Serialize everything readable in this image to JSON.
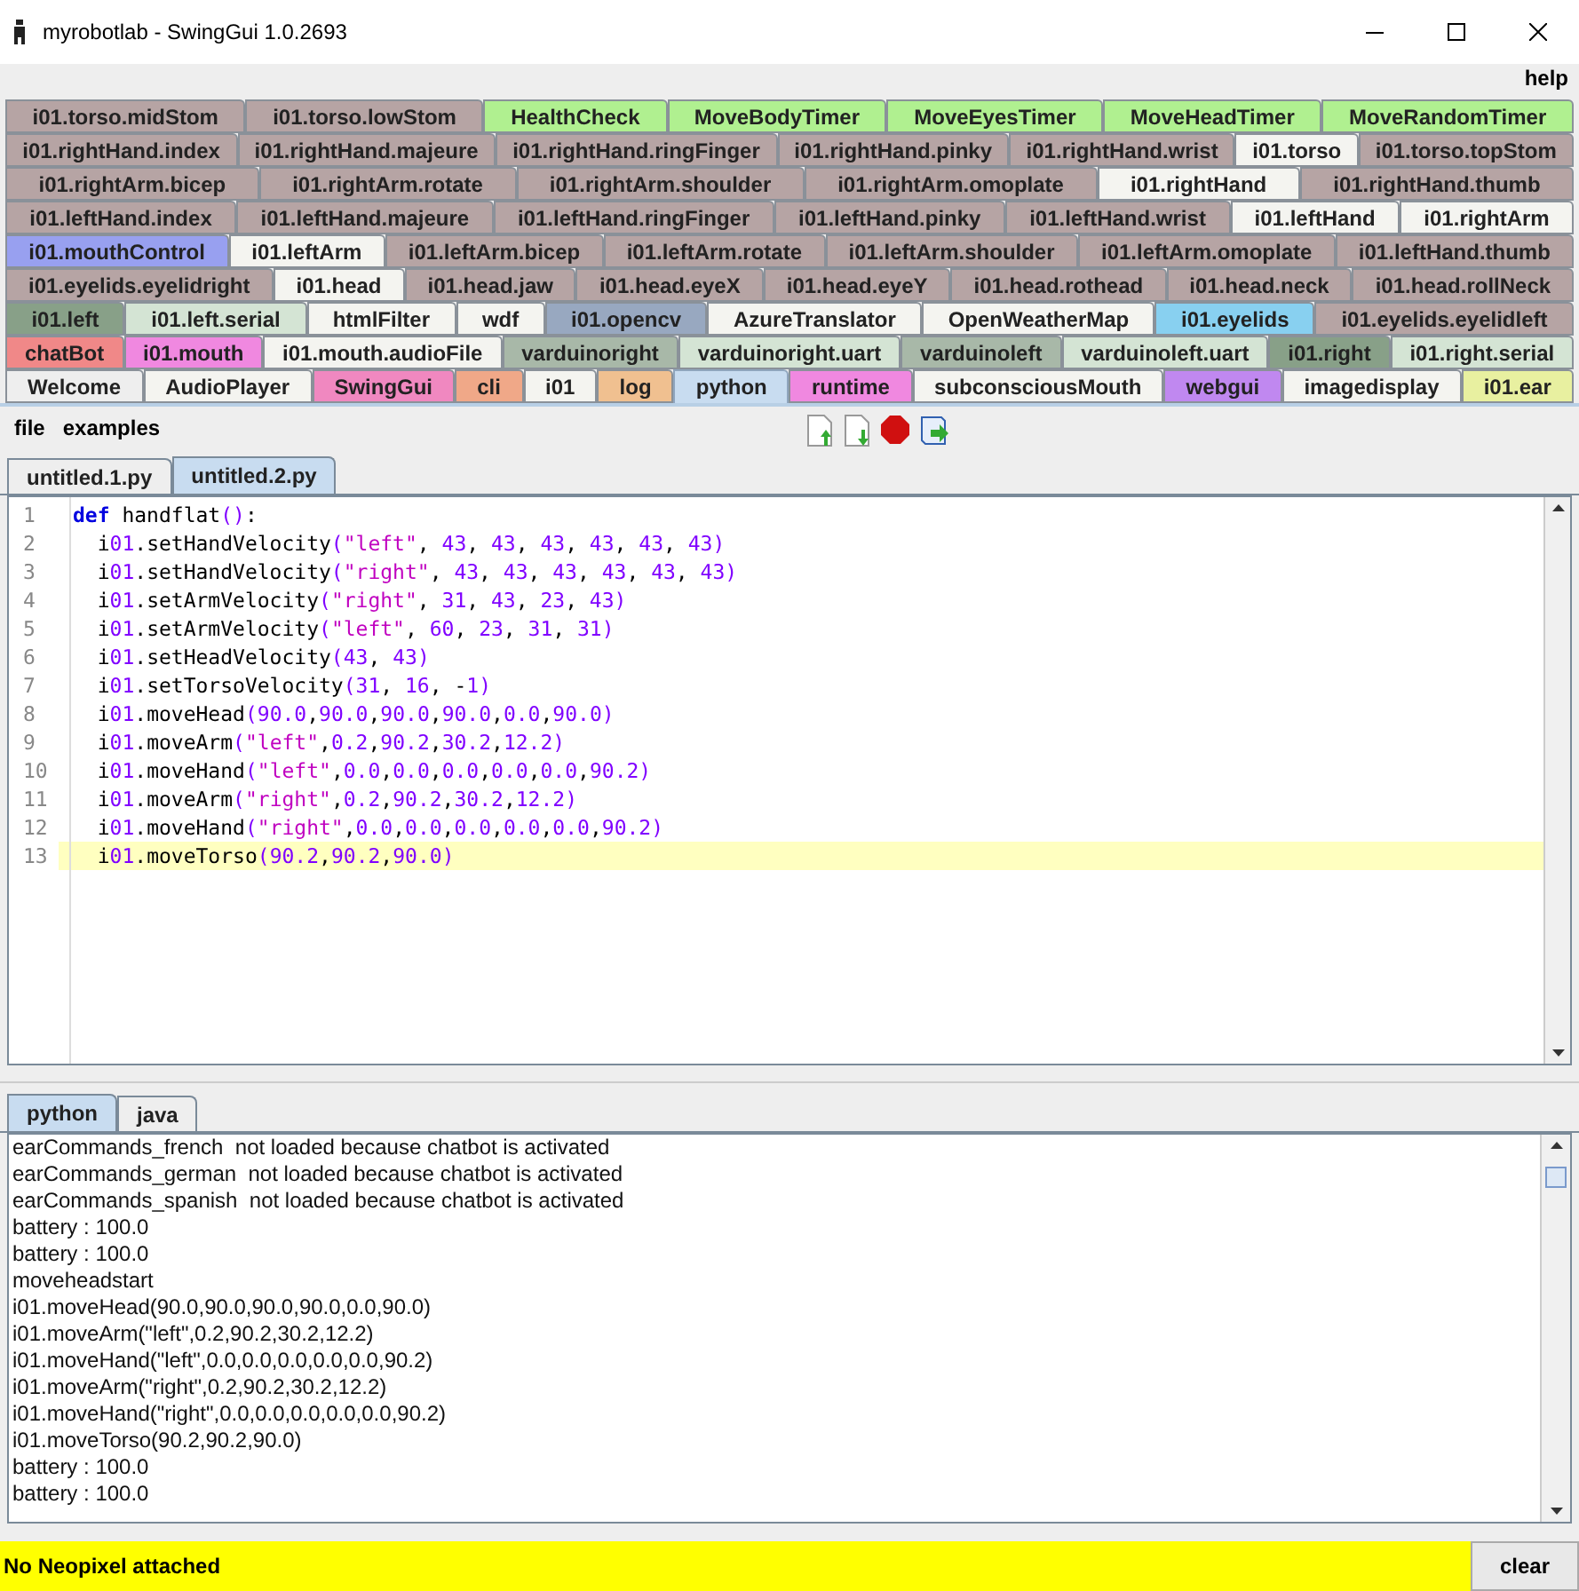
{
  "window": {
    "title": "myrobotlab - SwingGui 1.0.2693"
  },
  "menu": [
    "help"
  ],
  "tab_rows": [
    [
      {
        "label": "i01.torso.midStom",
        "color": "#b6a4a4",
        "selected": false
      },
      {
        "label": "i01.torso.lowStom",
        "color": "#b6a4a4",
        "selected": false
      },
      {
        "label": "HealthCheck",
        "color": "#b0f090",
        "selected": false
      },
      {
        "label": "MoveBodyTimer",
        "color": "#b0f090",
        "selected": false
      },
      {
        "label": "MoveEyesTimer",
        "color": "#b0f090",
        "selected": false
      },
      {
        "label": "MoveHeadTimer",
        "color": "#b0f090",
        "selected": false
      },
      {
        "label": "MoveRandomTimer",
        "color": "#b0f090",
        "selected": false
      }
    ],
    [
      {
        "label": "i01.rightHand.index",
        "color": "#b6a4a4",
        "selected": false
      },
      {
        "label": "i01.rightHand.majeure",
        "color": "#b6a4a4",
        "selected": false
      },
      {
        "label": "i01.rightHand.ringFinger",
        "color": "#b6a4a4",
        "selected": false
      },
      {
        "label": "i01.rightHand.pinky",
        "color": "#b6a4a4",
        "selected": false
      },
      {
        "label": "i01.rightHand.wrist",
        "color": "#b6a4a4",
        "selected": false
      },
      {
        "label": "i01.torso",
        "color": "#f4f4f0",
        "selected": false
      },
      {
        "label": "i01.torso.topStom",
        "color": "#b6a4a4",
        "selected": false
      }
    ],
    [
      {
        "label": "i01.rightArm.bicep",
        "color": "#b6a4a4",
        "selected": false
      },
      {
        "label": "i01.rightArm.rotate",
        "color": "#b6a4a4",
        "selected": false
      },
      {
        "label": "i01.rightArm.shoulder",
        "color": "#b6a4a4",
        "selected": false
      },
      {
        "label": "i01.rightArm.omoplate",
        "color": "#b6a4a4",
        "selected": false
      },
      {
        "label": "i01.rightHand",
        "color": "#f4f4f0",
        "selected": false
      },
      {
        "label": "i01.rightHand.thumb",
        "color": "#b6a4a4",
        "selected": false
      }
    ],
    [
      {
        "label": "i01.leftHand.index",
        "color": "#b6a4a4",
        "selected": false
      },
      {
        "label": "i01.leftHand.majeure",
        "color": "#b6a4a4",
        "selected": false
      },
      {
        "label": "i01.leftHand.ringFinger",
        "color": "#b6a4a4",
        "selected": false
      },
      {
        "label": "i01.leftHand.pinky",
        "color": "#b6a4a4",
        "selected": false
      },
      {
        "label": "i01.leftHand.wrist",
        "color": "#b6a4a4",
        "selected": false
      },
      {
        "label": "i01.leftHand",
        "color": "#f4f4f0",
        "selected": false
      },
      {
        "label": "i01.rightArm",
        "color": "#f4f4f0",
        "selected": false
      }
    ],
    [
      {
        "label": "i01.mouthControl",
        "color": "#98a0f0",
        "selected": false
      },
      {
        "label": "i01.leftArm",
        "color": "#f4f4f0",
        "selected": false
      },
      {
        "label": "i01.leftArm.bicep",
        "color": "#b6a4a4",
        "selected": false
      },
      {
        "label": "i01.leftArm.rotate",
        "color": "#b6a4a4",
        "selected": false
      },
      {
        "label": "i01.leftArm.shoulder",
        "color": "#b6a4a4",
        "selected": false
      },
      {
        "label": "i01.leftArm.omoplate",
        "color": "#b6a4a4",
        "selected": false
      },
      {
        "label": "i01.leftHand.thumb",
        "color": "#b6a4a4",
        "selected": false
      }
    ],
    [
      {
        "label": "i01.eyelids.eyelidright",
        "color": "#b6a4a4",
        "selected": false
      },
      {
        "label": "i01.head",
        "color": "#f4f4f0",
        "selected": false
      },
      {
        "label": "i01.head.jaw",
        "color": "#b6a4a4",
        "selected": false
      },
      {
        "label": "i01.head.eyeX",
        "color": "#b6a4a4",
        "selected": false
      },
      {
        "label": "i01.head.eyeY",
        "color": "#b6a4a4",
        "selected": false
      },
      {
        "label": "i01.head.rothead",
        "color": "#b6a4a4",
        "selected": false
      },
      {
        "label": "i01.head.neck",
        "color": "#b6a4a4",
        "selected": false
      },
      {
        "label": "i01.head.rollNeck",
        "color": "#b6a4a4",
        "selected": false
      }
    ],
    [
      {
        "label": "i01.left",
        "color": "#88a088",
        "selected": false
      },
      {
        "label": "i01.left.serial",
        "color": "#d4e4d4",
        "selected": false
      },
      {
        "label": "htmlFilter",
        "color": "#f4f4f0",
        "selected": false
      },
      {
        "label": "wdf",
        "color": "#f4f4f0",
        "selected": false
      },
      {
        "label": "i01.opencv",
        "color": "#98a8c0",
        "selected": false
      },
      {
        "label": "AzureTranslator",
        "color": "#f4f4f0",
        "selected": false
      },
      {
        "label": "OpenWeatherMap",
        "color": "#f4f4f0",
        "selected": false
      },
      {
        "label": "i01.eyelids",
        "color": "#88d0f0",
        "selected": false
      },
      {
        "label": "i01.eyelids.eyelidleft",
        "color": "#b6a4a4",
        "selected": false
      }
    ],
    [
      {
        "label": "chatBot",
        "color": "#f08888",
        "selected": false
      },
      {
        "label": "i01.mouth",
        "color": "#f088e0",
        "selected": false
      },
      {
        "label": "i01.mouth.audioFile",
        "color": "#f4f4f0",
        "selected": false
      },
      {
        "label": "varduinoright",
        "color": "#a8b8a8",
        "selected": false
      },
      {
        "label": "varduinoright.uart",
        "color": "#d4e4d4",
        "selected": false
      },
      {
        "label": "varduinoleft",
        "color": "#a8b8a8",
        "selected": false
      },
      {
        "label": "varduinoleft.uart",
        "color": "#d4e4d4",
        "selected": false
      },
      {
        "label": "i01.right",
        "color": "#88a088",
        "selected": false
      },
      {
        "label": "i01.right.serial",
        "color": "#d4e4d4",
        "selected": false
      }
    ],
    [
      {
        "label": "Welcome",
        "color": "#eeeeee",
        "selected": false
      },
      {
        "label": "AudioPlayer",
        "color": "#f4f4f0",
        "selected": false
      },
      {
        "label": "SwingGui",
        "color": "#f088c0",
        "selected": false
      },
      {
        "label": "cli",
        "color": "#f0a888",
        "selected": false
      },
      {
        "label": "i01",
        "color": "#f4f4f0",
        "selected": false
      },
      {
        "label": "log",
        "color": "#f0c090",
        "selected": false
      },
      {
        "label": "python",
        "color": "#c8dcf0",
        "selected": true
      },
      {
        "label": "runtime",
        "color": "#f088e0",
        "selected": false
      },
      {
        "label": "subconsciousMouth",
        "color": "#f4f4f0",
        "selected": false
      },
      {
        "label": "webgui",
        "color": "#c088f0",
        "selected": false
      },
      {
        "label": "imagedisplay",
        "color": "#f4f4f0",
        "selected": false
      },
      {
        "label": "i01.ear",
        "color": "#e8f0a0",
        "selected": false
      }
    ]
  ],
  "python_menu": [
    "file",
    "examples"
  ],
  "file_tabs": [
    {
      "label": "untitled.1.py",
      "selected": false
    },
    {
      "label": "untitled.2.py",
      "selected": true
    }
  ],
  "editor": {
    "lines": [
      {
        "number": "1",
        "code": "def handflat():",
        "current": false
      },
      {
        "number": "2",
        "code": "  i01.setHandVelocity(\"left\", 43, 43, 43, 43, 43, 43)",
        "current": false
      },
      {
        "number": "3",
        "code": "  i01.setHandVelocity(\"right\", 43, 43, 43, 43, 43, 43)",
        "current": false
      },
      {
        "number": "4",
        "code": "  i01.setArmVelocity(\"right\", 31, 43, 23, 43)",
        "current": false
      },
      {
        "number": "5",
        "code": "  i01.setArmVelocity(\"left\", 60, 23, 31, 31)",
        "current": false
      },
      {
        "number": "6",
        "code": "  i01.setHeadVelocity(43, 43)",
        "current": false
      },
      {
        "number": "7",
        "code": "  i01.setTorsoVelocity(31, 16, -1)",
        "current": false
      },
      {
        "number": "8",
        "code": "  i01.moveHead(90.0,90.0,90.0,90.0,0.0,90.0)",
        "current": false
      },
      {
        "number": "9",
        "code": "  i01.moveArm(\"left\",0.2,90.2,30.2,12.2)",
        "current": false
      },
      {
        "number": "10",
        "code": "  i01.moveHand(\"left\",0.0,0.0,0.0,0.0,0.0,90.2)",
        "current": false
      },
      {
        "number": "11",
        "code": "  i01.moveArm(\"right\",0.2,90.2,30.2,12.2)",
        "current": false
      },
      {
        "number": "12",
        "code": "  i01.moveHand(\"right\",0.0,0.0,0.0,0.0,0.0,90.2)",
        "current": false
      },
      {
        "number": "13",
        "code": "  i01.moveTorso(90.2,90.2,90.0)",
        "current": true
      }
    ]
  },
  "console_tabs": [
    {
      "label": "python",
      "selected": true
    },
    {
      "label": "java",
      "selected": false
    }
  ],
  "console_lines": [
    "earCommands_french  not loaded because chatbot is activated",
    "earCommands_german  not loaded because chatbot is activated",
    "earCommands_spanish  not loaded because chatbot is activated",
    "battery : 100.0",
    "battery : 100.0",
    "moveheadstart",
    "i01.moveHead(90.0,90.0,90.0,90.0,0.0,90.0)",
    "i01.moveArm(\"left\",0.2,90.2,30.2,12.2)",
    "i01.moveHand(\"left\",0.0,0.0,0.0,0.0,0.0,90.2)",
    "i01.moveArm(\"right\",0.2,90.2,30.2,12.2)",
    "i01.moveHand(\"right\",0.0,0.0,0.0,0.0,0.0,90.2)",
    "i01.moveTorso(90.2,90.2,90.0)",
    "battery : 100.0",
    "battery : 100.0"
  ],
  "status_bar": {
    "message": "No Neopixel attached",
    "button": "clear"
  }
}
